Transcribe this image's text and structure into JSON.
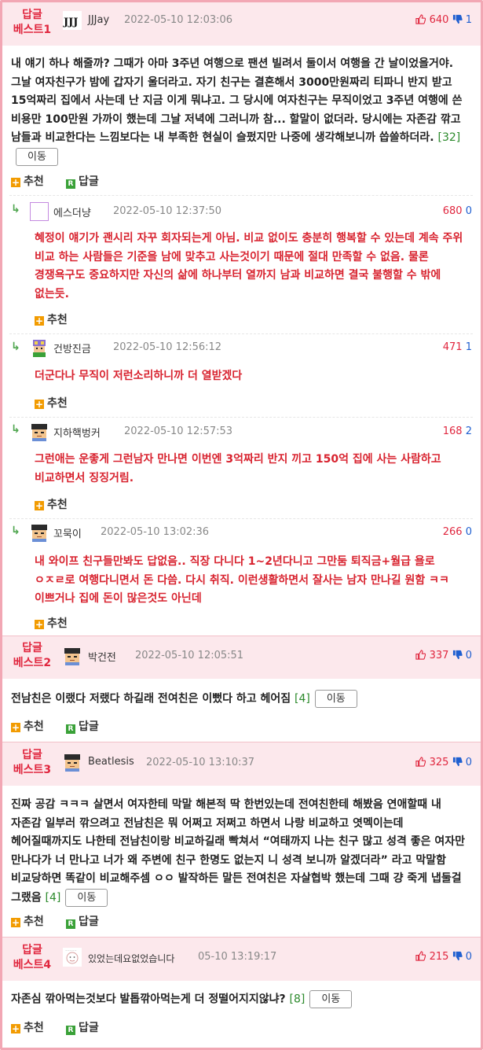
{
  "actions": {
    "recommend": "추천",
    "reply": "답글",
    "move": "이동"
  },
  "colors": {
    "accent": "#e0263e",
    "frame": "#f2a7b4",
    "header_bg": "#fce8ec",
    "down": "#1f5fd0",
    "ref": "#2c8a2c"
  },
  "best1": {
    "label_top": "답글",
    "label_bottom": "베스트1",
    "nick": "JJJay",
    "date": "2022-05-10 12:03:06",
    "up": "640",
    "down": "1",
    "text": "내 얘기 하나 해줄까? 그때가 아마 3주년 여행으로 팬션 빌려서 둘이서 여행을 간 날이었을거야. 그날 여자친구가 밤에 갑자기 울더라고. 자기 친구는 결혼해서 3000만원짜리 티파니 반지 받고 15억짜리 집에서 사는데 난 지금 이게 뭐냐고. 그 당시에 여자친구는 무직이었고 3주년 여행에 쓴 비용만 100만원 가까이 했는데 그날 저녁에 그러니까 참... 할말이 없더라. 당시에는 자존감 깎고 남들과 비교한다는 느낌보다는 내 부족한 현실이 슬펐지만 나중에 생각해보니까 씁쓸하더라.",
    "ref": "[32]"
  },
  "replies": [
    {
      "nick": "에스더냥",
      "date": "2022-05-10 12:37:50",
      "up": "680",
      "down": "0",
      "text": "혜정이 얘기가 괜시리 자꾸 회자되는게 아님. 비교 없이도 충분히 행복할 수 있는데 계속 주위 비교 하는 사람들은 기준을 남에 맞추고 사는것이기 때문에 절대 만족할 수 없음. 물론 경쟁욕구도 중요하지만 자신의 삶에 하나부터 열까지 남과 비교하면 결국 불행할 수 밖에 없는듯."
    },
    {
      "nick": "건방진금",
      "date": "2022-05-10 12:56:12",
      "up": "471",
      "down": "1",
      "text": "더군다나 무직이 저런소리하니까 더 열받겠다"
    },
    {
      "nick": "지하핵벙커",
      "date": "2022-05-10 12:57:53",
      "up": "168",
      "down": "2",
      "text": "그런애는 운좋게 그런남자 만나면 이번엔 3억짜리 반지 끼고 150억 집에 사는 사람하고 비교하면서 징징거림."
    },
    {
      "nick": "꼬묵이",
      "date": "2022-05-10 13:02:36",
      "up": "266",
      "down": "0",
      "text": "내 와이프 친구들만봐도 답없음.. 직장 다니다 1~2년다니고 그만둠 퇴직금+월급 욜로 ㅇㅈㄹ로 여행다니면서 돈 다씀. 다시 취직. 이런생활하면서 잘사는 남자 만나길 원함 ㅋㅋ 이쁘거나 집에 돈이 많은것도 아닌데"
    }
  ],
  "best2": {
    "label_top": "답글",
    "label_bottom": "베스트2",
    "nick": "박건전",
    "date": "2022-05-10 12:05:51",
    "up": "337",
    "down": "0",
    "text": "전남친은 이랬다 저랬다 하길래 전여친은 이뻤다 하고 헤어짐",
    "ref": "[4]"
  },
  "best3": {
    "label_top": "답글",
    "label_bottom": "베스트3",
    "nick": "Beatlesis",
    "date": "2022-05-10 13:10:37",
    "up": "325",
    "down": "0",
    "text": "진짜 공감 ㅋㅋㅋ 살면서 여자한테 막말 해본적 딱 한번있는데 전여친한테 해봤음 연애할때 내 자존감 일부러 깎으려고 전남친은 뭐 어쩌고 저쩌고 하면서 나랑 비교하고 엿멕이는데 헤어질때까지도 나한테 전남친이랑 비교하길래 빡쳐서 “여태까지 나는 친구 많고 성격 좋은 여자만 만나다가 너 만나고 너가 왜 주변에 친구 한명도 없는지 니 성격 보니까 알겠더라” 라고 막말함 비교당하면 똑같이 비교해주셈 ㅇㅇ 발작하든 말든 전여친은 자살협박 했는데 그때 걍 죽게 냅둘걸 그랬음",
    "ref": "[4]"
  },
  "best4": {
    "label_top": "답글",
    "label_bottom": "베스트4",
    "nick": "있었는데요없었습니다",
    "date": "05-10 13:19:17",
    "up": "215",
    "down": "0",
    "text": "자존심 깎아먹는것보다 발톱깎아먹는게 더 정떨어지지않냐?",
    "ref": "[8]"
  }
}
